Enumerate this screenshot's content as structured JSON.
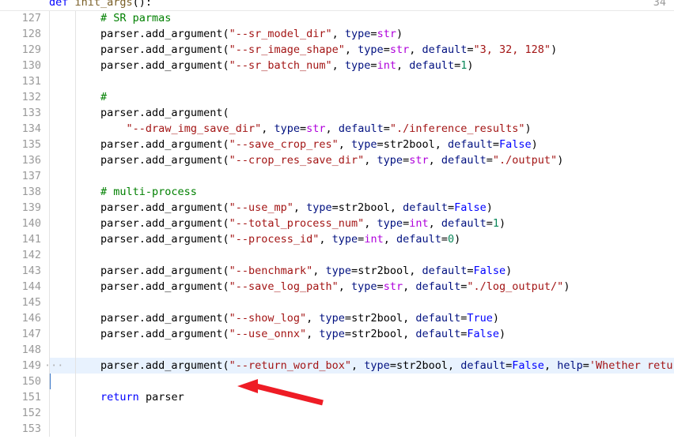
{
  "app": {
    "type": "code-editor",
    "language": "python",
    "theme_background": "#ffffff",
    "highlight_color": "#e8f2fe",
    "annotation_arrow_color": "#ee1c25"
  },
  "sticky_header": {
    "line_number": "34",
    "tokens": [
      {
        "t": "def ",
        "c": "kw"
      },
      {
        "t": "init_args",
        "c": "fn"
      },
      {
        "t": "():",
        "c": "op"
      }
    ]
  },
  "editor": {
    "first_partial_line_number": "126",
    "highlighted_line": 149,
    "cursor_line": 150,
    "lines": [
      {
        "num": "127",
        "tokens": [
          {
            "t": "        # SR parmas",
            "c": "cmt"
          }
        ]
      },
      {
        "num": "128",
        "tokens": [
          {
            "t": "        parser",
            "c": "op"
          },
          {
            "t": ".add_argument(",
            "c": "op"
          },
          {
            "t": "\"--sr_model_dir\"",
            "c": "str"
          },
          {
            "t": ", ",
            "c": "op"
          },
          {
            "t": "type",
            "c": "param"
          },
          {
            "t": "=",
            "c": "op"
          },
          {
            "t": "str",
            "c": "kw2"
          },
          {
            "t": ")",
            "c": "op"
          }
        ]
      },
      {
        "num": "129",
        "tokens": [
          {
            "t": "        parser",
            "c": "op"
          },
          {
            "t": ".add_argument(",
            "c": "op"
          },
          {
            "t": "\"--sr_image_shape\"",
            "c": "str"
          },
          {
            "t": ", ",
            "c": "op"
          },
          {
            "t": "type",
            "c": "param"
          },
          {
            "t": "=",
            "c": "op"
          },
          {
            "t": "str",
            "c": "kw2"
          },
          {
            "t": ", ",
            "c": "op"
          },
          {
            "t": "default",
            "c": "param"
          },
          {
            "t": "=",
            "c": "op"
          },
          {
            "t": "\"3, 32, 128\"",
            "c": "str"
          },
          {
            "t": ")",
            "c": "op"
          }
        ]
      },
      {
        "num": "130",
        "tokens": [
          {
            "t": "        parser",
            "c": "op"
          },
          {
            "t": ".add_argument(",
            "c": "op"
          },
          {
            "t": "\"--sr_batch_num\"",
            "c": "str"
          },
          {
            "t": ", ",
            "c": "op"
          },
          {
            "t": "type",
            "c": "param"
          },
          {
            "t": "=",
            "c": "op"
          },
          {
            "t": "int",
            "c": "kw2"
          },
          {
            "t": ", ",
            "c": "op"
          },
          {
            "t": "default",
            "c": "param"
          },
          {
            "t": "=",
            "c": "op"
          },
          {
            "t": "1",
            "c": "num"
          },
          {
            "t": ")",
            "c": "op"
          }
        ]
      },
      {
        "num": "131",
        "tokens": []
      },
      {
        "num": "132",
        "tokens": [
          {
            "t": "        #",
            "c": "cmt"
          }
        ]
      },
      {
        "num": "133",
        "tokens": [
          {
            "t": "        parser",
            "c": "op"
          },
          {
            "t": ".add_argument(",
            "c": "op"
          }
        ]
      },
      {
        "num": "134",
        "tokens": [
          {
            "t": "            ",
            "c": "op"
          },
          {
            "t": "\"--draw_img_save_dir\"",
            "c": "str"
          },
          {
            "t": ", ",
            "c": "op"
          },
          {
            "t": "type",
            "c": "param"
          },
          {
            "t": "=",
            "c": "op"
          },
          {
            "t": "str",
            "c": "kw2"
          },
          {
            "t": ", ",
            "c": "op"
          },
          {
            "t": "default",
            "c": "param"
          },
          {
            "t": "=",
            "c": "op"
          },
          {
            "t": "\"./inference_results\"",
            "c": "str"
          },
          {
            "t": ")",
            "c": "op"
          }
        ]
      },
      {
        "num": "135",
        "tokens": [
          {
            "t": "        parser",
            "c": "op"
          },
          {
            "t": ".add_argument(",
            "c": "op"
          },
          {
            "t": "\"--save_crop_res\"",
            "c": "str"
          },
          {
            "t": ", ",
            "c": "op"
          },
          {
            "t": "type",
            "c": "param"
          },
          {
            "t": "=",
            "c": "op"
          },
          {
            "t": "str2bool",
            "c": "op"
          },
          {
            "t": ", ",
            "c": "op"
          },
          {
            "t": "default",
            "c": "param"
          },
          {
            "t": "=",
            "c": "op"
          },
          {
            "t": "False",
            "c": "bool"
          },
          {
            "t": ")",
            "c": "op"
          }
        ]
      },
      {
        "num": "136",
        "tokens": [
          {
            "t": "        parser",
            "c": "op"
          },
          {
            "t": ".add_argument(",
            "c": "op"
          },
          {
            "t": "\"--crop_res_save_dir\"",
            "c": "str"
          },
          {
            "t": ", ",
            "c": "op"
          },
          {
            "t": "type",
            "c": "param"
          },
          {
            "t": "=",
            "c": "op"
          },
          {
            "t": "str",
            "c": "kw2"
          },
          {
            "t": ", ",
            "c": "op"
          },
          {
            "t": "default",
            "c": "param"
          },
          {
            "t": "=",
            "c": "op"
          },
          {
            "t": "\"./output\"",
            "c": "str"
          },
          {
            "t": ")",
            "c": "op"
          }
        ]
      },
      {
        "num": "137",
        "tokens": []
      },
      {
        "num": "138",
        "tokens": [
          {
            "t": "        # multi-process",
            "c": "cmt"
          }
        ]
      },
      {
        "num": "139",
        "tokens": [
          {
            "t": "        parser",
            "c": "op"
          },
          {
            "t": ".add_argument(",
            "c": "op"
          },
          {
            "t": "\"--use_mp\"",
            "c": "str"
          },
          {
            "t": ", ",
            "c": "op"
          },
          {
            "t": "type",
            "c": "param"
          },
          {
            "t": "=",
            "c": "op"
          },
          {
            "t": "str2bool",
            "c": "op"
          },
          {
            "t": ", ",
            "c": "op"
          },
          {
            "t": "default",
            "c": "param"
          },
          {
            "t": "=",
            "c": "op"
          },
          {
            "t": "False",
            "c": "bool"
          },
          {
            "t": ")",
            "c": "op"
          }
        ]
      },
      {
        "num": "140",
        "tokens": [
          {
            "t": "        parser",
            "c": "op"
          },
          {
            "t": ".add_argument(",
            "c": "op"
          },
          {
            "t": "\"--total_process_num\"",
            "c": "str"
          },
          {
            "t": ", ",
            "c": "op"
          },
          {
            "t": "type",
            "c": "param"
          },
          {
            "t": "=",
            "c": "op"
          },
          {
            "t": "int",
            "c": "kw2"
          },
          {
            "t": ", ",
            "c": "op"
          },
          {
            "t": "default",
            "c": "param"
          },
          {
            "t": "=",
            "c": "op"
          },
          {
            "t": "1",
            "c": "num"
          },
          {
            "t": ")",
            "c": "op"
          }
        ]
      },
      {
        "num": "141",
        "tokens": [
          {
            "t": "        parser",
            "c": "op"
          },
          {
            "t": ".add_argument(",
            "c": "op"
          },
          {
            "t": "\"--process_id\"",
            "c": "str"
          },
          {
            "t": ", ",
            "c": "op"
          },
          {
            "t": "type",
            "c": "param"
          },
          {
            "t": "=",
            "c": "op"
          },
          {
            "t": "int",
            "c": "kw2"
          },
          {
            "t": ", ",
            "c": "op"
          },
          {
            "t": "default",
            "c": "param"
          },
          {
            "t": "=",
            "c": "op"
          },
          {
            "t": "0",
            "c": "num"
          },
          {
            "t": ")",
            "c": "op"
          }
        ]
      },
      {
        "num": "142",
        "tokens": []
      },
      {
        "num": "143",
        "tokens": [
          {
            "t": "        parser",
            "c": "op"
          },
          {
            "t": ".add_argument(",
            "c": "op"
          },
          {
            "t": "\"--benchmark\"",
            "c": "str"
          },
          {
            "t": ", ",
            "c": "op"
          },
          {
            "t": "type",
            "c": "param"
          },
          {
            "t": "=",
            "c": "op"
          },
          {
            "t": "str2bool",
            "c": "op"
          },
          {
            "t": ", ",
            "c": "op"
          },
          {
            "t": "default",
            "c": "param"
          },
          {
            "t": "=",
            "c": "op"
          },
          {
            "t": "False",
            "c": "bool"
          },
          {
            "t": ")",
            "c": "op"
          }
        ]
      },
      {
        "num": "144",
        "tokens": [
          {
            "t": "        parser",
            "c": "op"
          },
          {
            "t": ".add_argument(",
            "c": "op"
          },
          {
            "t": "\"--save_log_path\"",
            "c": "str"
          },
          {
            "t": ", ",
            "c": "op"
          },
          {
            "t": "type",
            "c": "param"
          },
          {
            "t": "=",
            "c": "op"
          },
          {
            "t": "str",
            "c": "kw2"
          },
          {
            "t": ", ",
            "c": "op"
          },
          {
            "t": "default",
            "c": "param"
          },
          {
            "t": "=",
            "c": "op"
          },
          {
            "t": "\"./log_output/\"",
            "c": "str"
          },
          {
            "t": ")",
            "c": "op"
          }
        ]
      },
      {
        "num": "145",
        "tokens": []
      },
      {
        "num": "146",
        "tokens": [
          {
            "t": "        parser",
            "c": "op"
          },
          {
            "t": ".add_argument(",
            "c": "op"
          },
          {
            "t": "\"--show_log\"",
            "c": "str"
          },
          {
            "t": ", ",
            "c": "op"
          },
          {
            "t": "type",
            "c": "param"
          },
          {
            "t": "=",
            "c": "op"
          },
          {
            "t": "str2bool",
            "c": "op"
          },
          {
            "t": ", ",
            "c": "op"
          },
          {
            "t": "default",
            "c": "param"
          },
          {
            "t": "=",
            "c": "op"
          },
          {
            "t": "True",
            "c": "bool"
          },
          {
            "t": ")",
            "c": "op"
          }
        ]
      },
      {
        "num": "147",
        "tokens": [
          {
            "t": "        parser",
            "c": "op"
          },
          {
            "t": ".add_argument(",
            "c": "op"
          },
          {
            "t": "\"--use_onnx\"",
            "c": "str"
          },
          {
            "t": ", ",
            "c": "op"
          },
          {
            "t": "type",
            "c": "param"
          },
          {
            "t": "=",
            "c": "op"
          },
          {
            "t": "str2bool",
            "c": "op"
          },
          {
            "t": ", ",
            "c": "op"
          },
          {
            "t": "default",
            "c": "param"
          },
          {
            "t": "=",
            "c": "op"
          },
          {
            "t": "False",
            "c": "bool"
          },
          {
            "t": ")",
            "c": "op"
          }
        ]
      },
      {
        "num": "148",
        "tokens": []
      },
      {
        "num": "149",
        "tokens": [
          {
            "t": "        parser",
            "c": "op"
          },
          {
            "t": ".add_argument(",
            "c": "op"
          },
          {
            "t": "\"--return_word_box\"",
            "c": "str"
          },
          {
            "t": ", ",
            "c": "op"
          },
          {
            "t": "type",
            "c": "param"
          },
          {
            "t": "=",
            "c": "op"
          },
          {
            "t": "str2bool",
            "c": "op"
          },
          {
            "t": ", ",
            "c": "op"
          },
          {
            "t": "default",
            "c": "param"
          },
          {
            "t": "=",
            "c": "op"
          },
          {
            "t": "False",
            "c": "bool"
          },
          {
            "t": ", ",
            "c": "op"
          },
          {
            "t": "help",
            "c": "param"
          },
          {
            "t": "=",
            "c": "op"
          },
          {
            "t": "'Whether return t",
            "c": "str"
          }
        ]
      },
      {
        "num": "150",
        "tokens": []
      },
      {
        "num": "151",
        "tokens": [
          {
            "t": "        ",
            "c": "op"
          },
          {
            "t": "return",
            "c": "kw"
          },
          {
            "t": " parser",
            "c": "op"
          }
        ]
      },
      {
        "num": "152",
        "tokens": []
      },
      {
        "num": "153",
        "tokens": []
      }
    ]
  }
}
